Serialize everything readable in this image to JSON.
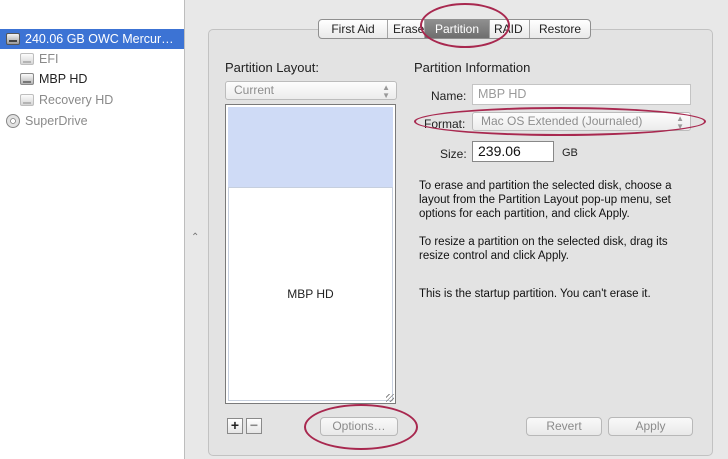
{
  "sidebar": {
    "items": [
      {
        "label": "240.06 GB OWC Mercur…",
        "icon": "hard-drive-icon",
        "selected": true,
        "dim": false
      },
      {
        "label": "EFI",
        "icon": "volume-icon",
        "selected": false,
        "dim": true
      },
      {
        "label": "MBP HD",
        "icon": "volume-icon",
        "selected": false,
        "dim": false
      },
      {
        "label": "Recovery HD",
        "icon": "volume-icon",
        "selected": false,
        "dim": true
      },
      {
        "label": "SuperDrive",
        "icon": "optical-drive-icon",
        "selected": false,
        "dim": true
      }
    ]
  },
  "tabs": [
    {
      "label": "First Aid",
      "active": false
    },
    {
      "label": "Erase",
      "active": false
    },
    {
      "label": "Partition",
      "active": true
    },
    {
      "label": "RAID",
      "active": false
    },
    {
      "label": "Restore",
      "active": false
    }
  ],
  "layout": {
    "heading": "Partition Layout:",
    "popup_value": "Current",
    "partition_name": "MBP HD",
    "add_label": "+",
    "remove_label": "−",
    "options_label": "Options…"
  },
  "info": {
    "heading": "Partition Information",
    "name_label": "Name:",
    "name_value": "MBP HD",
    "format_label": "Format:",
    "format_value": "Mac OS Extended (Journaled)",
    "size_label": "Size:",
    "size_value": "239.06",
    "size_unit": "GB",
    "text1": "To erase and partition the selected disk, choose a layout from the Partition Layout pop-up menu, set options for each partition, and click Apply.",
    "text2": "To resize a partition on the selected disk, drag its resize control and click Apply.",
    "text3": "This is the startup partition. You can't erase it."
  },
  "buttons": {
    "revert": "Revert",
    "apply": "Apply"
  },
  "annotation_color": "#a8284f",
  "selection_color": "#3c73d4"
}
